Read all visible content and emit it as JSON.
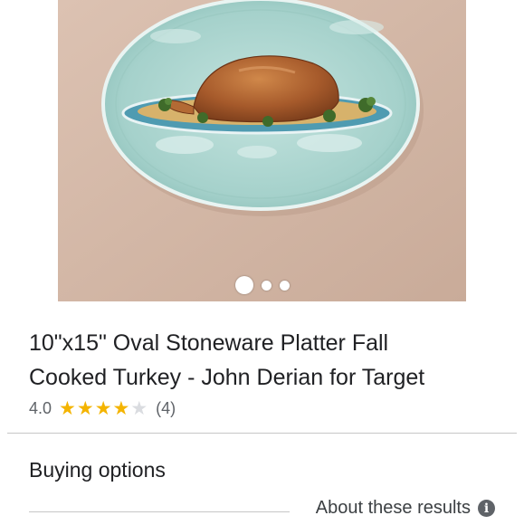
{
  "product": {
    "title_line1": "10\"x15\" Oval Stoneware Platter Fall",
    "title_line2": "Cooked Turkey - John Derian for Target",
    "rating": "4.0",
    "review_count": "(4)",
    "stars_filled": 4,
    "stars_total": 5,
    "image_slide_current": 1,
    "image_slide_total": 3,
    "image_icon": "platter-photo"
  },
  "sections": {
    "buying_options": "Buying options",
    "about_results": "About these results"
  },
  "colors": {
    "star": "#f4b400",
    "star_empty": "#dadce0",
    "text": "#202124",
    "muted": "#5f6368",
    "image_background": "#d3b8a8",
    "platter": "#a9d4cf"
  }
}
